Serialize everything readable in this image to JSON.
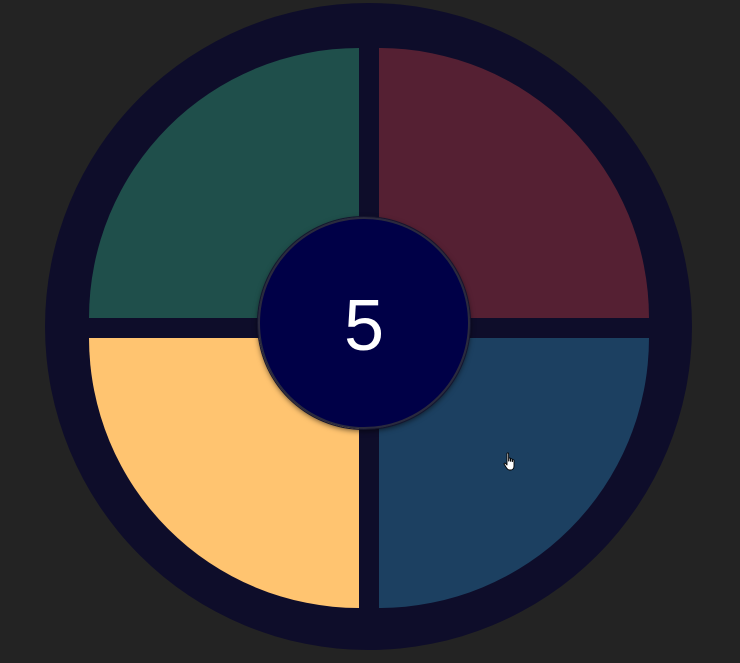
{
  "game": {
    "counter": "5",
    "pads": [
      {
        "id": "top-left",
        "color": "#1f4f4b"
      },
      {
        "id": "top-right",
        "color": "#552033"
      },
      {
        "id": "bottom-left",
        "color": "#ffc470"
      },
      {
        "id": "bottom-right",
        "color": "#1c4061"
      }
    ],
    "board_color": "#0e0d2a",
    "hub_color": "#000047",
    "background": "#232323"
  },
  "cursor": {
    "icon": "hand-pointer-icon"
  }
}
